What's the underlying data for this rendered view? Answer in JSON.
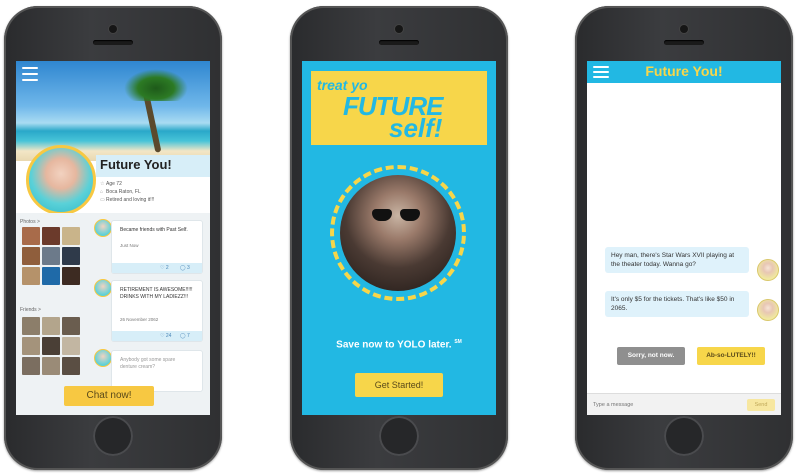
{
  "profile_screen": {
    "name": "Future You!",
    "age": "Age 72",
    "location": "Boca Raton, FL",
    "status": "Retired and loving it!!!",
    "photos_label": "Photos >",
    "friends_label": "Friends >",
    "posts": [
      {
        "text": "Became friends with Past Self.",
        "time": "Just Now",
        "likes": "2",
        "comments": "3"
      },
      {
        "text": "RETIREMENT IS AWESOME!!!!! DRINKS WITH MY LADIEZZ!!!",
        "time": "26 November 2062",
        "likes": "24",
        "comments": "7"
      },
      {
        "text": "Anybody got some spare denture cream?"
      }
    ],
    "chat_button": "Chat now!"
  },
  "landing_screen": {
    "logo_line1": "treat yo",
    "logo_line2": "FUTURE",
    "logo_line3": "self!",
    "tagline": "Save now to YOLO later.",
    "tagline_mark": "SM",
    "cta": "Get Started!"
  },
  "chat_screen": {
    "title": "Future You!",
    "messages": [
      {
        "text": "Hey man, there's Star Wars XVII playing at the theater today. Wanna go?"
      },
      {
        "text": "It's only $5 for the tickets. That's like $50 in 2065."
      }
    ],
    "reply_no": "Sorry, not now.",
    "reply_yes": "Ab-so-LUTELY!!",
    "input_placeholder": "Type a message",
    "send_label": "Send"
  },
  "colors": {
    "accent_blue": "#22b8e3",
    "accent_yellow": "#f7d64a",
    "phone_body": "#2f3032"
  }
}
